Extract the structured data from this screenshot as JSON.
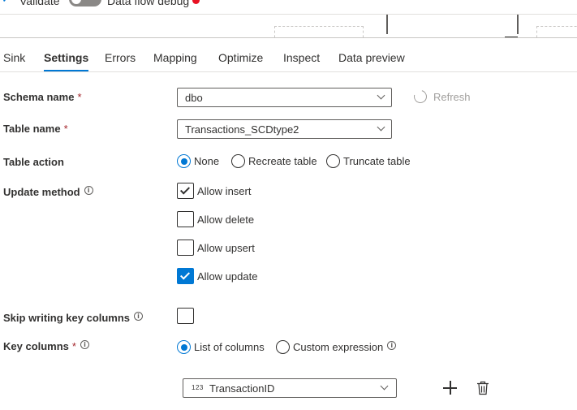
{
  "toolbar": {
    "validate_label": "Validate",
    "debug_label": "Data flow debug"
  },
  "tabs": [
    {
      "label": "Sink",
      "active": false
    },
    {
      "label": "Settings",
      "active": true
    },
    {
      "label": "Errors",
      "active": false
    },
    {
      "label": "Mapping",
      "active": false
    },
    {
      "label": "Optimize",
      "active": false
    },
    {
      "label": "Inspect",
      "active": false
    },
    {
      "label": "Data preview",
      "active": false
    }
  ],
  "form": {
    "schema_name": {
      "label": "Schema name",
      "required": "*",
      "value": "dbo"
    },
    "refresh_label": "Refresh",
    "table_name": {
      "label": "Table name",
      "required": "*",
      "value": "Transactions_SCDtype2"
    },
    "table_action": {
      "label": "Table action",
      "options": [
        "None",
        "Recreate table",
        "Truncate table"
      ],
      "selected": "None"
    },
    "update_method": {
      "label": "Update method",
      "options": [
        {
          "label": "Allow insert",
          "checked": true
        },
        {
          "label": "Allow delete",
          "checked": false
        },
        {
          "label": "Allow upsert",
          "checked": false
        },
        {
          "label": "Allow update",
          "checked": true
        }
      ]
    },
    "skip_writing_key_columns": {
      "label": "Skip writing key columns",
      "checked": false
    },
    "key_columns": {
      "label": "Key columns",
      "required": "*",
      "options": [
        "List of columns",
        "Custom expression"
      ],
      "selected": "List of columns",
      "column_type_badge": "123",
      "column_value": "TransactionID"
    }
  },
  "colors": {
    "accent": "#0078d4",
    "required": "#a4262c",
    "debug_dot": "#e81123"
  }
}
